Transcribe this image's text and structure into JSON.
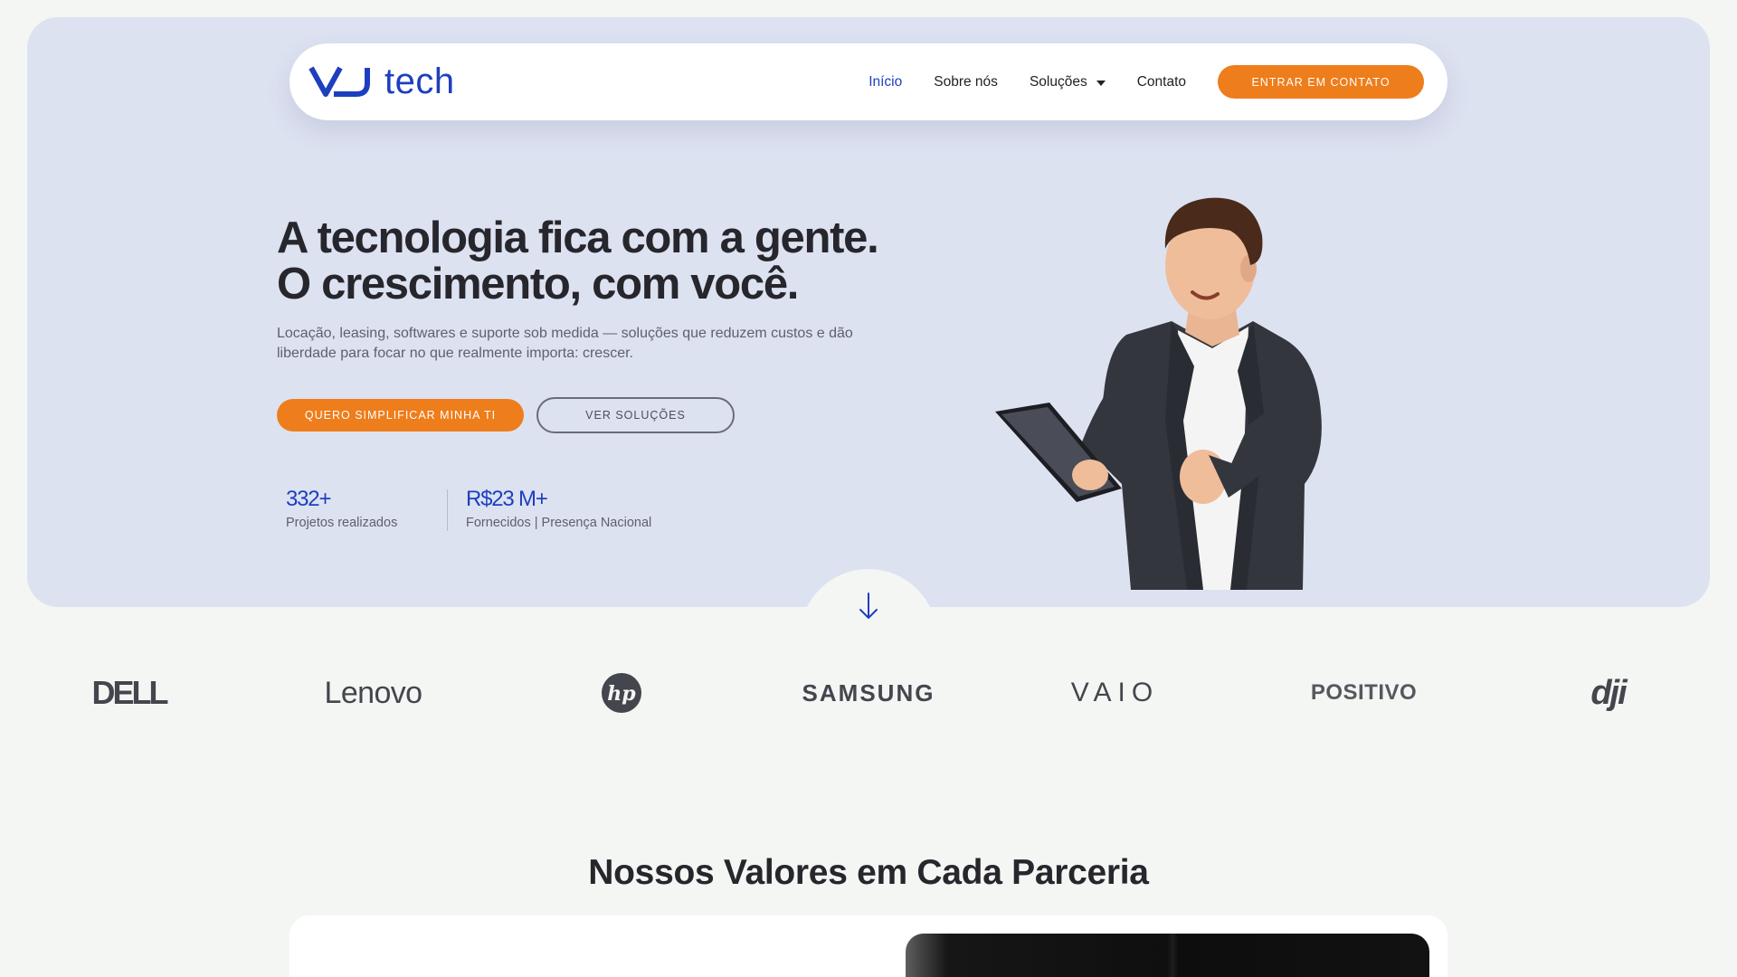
{
  "brand": {
    "logo_text": "tech",
    "color": "#1d3fbf",
    "accent": "#ee7d1b"
  },
  "nav": {
    "items": [
      {
        "label": "Início",
        "active": true
      },
      {
        "label": "Sobre nós"
      },
      {
        "label": "Soluções",
        "has_dropdown": true
      },
      {
        "label": "Contato"
      }
    ],
    "cta_label": "ENTRAR EM CONTATO"
  },
  "hero": {
    "headline_line1": "A tecnologia fica com a gente.",
    "headline_line2": "O crescimento, com você.",
    "subtext": "Locação, leasing, softwares e suporte sob medida — soluções que reduzem custos e dão liberdade para focar no que realmente importa: crescer.",
    "cta_primary": "QUERO SIMPLIFICAR MINHA TI",
    "cta_secondary": "VER SOLUÇÕES",
    "stats": [
      {
        "value": "332+",
        "label": "Projetos realizados"
      },
      {
        "value": "R$23 M+",
        "label": "Fornecidos | Presença Nacional"
      }
    ],
    "scroll_icon": "arrow-down-icon"
  },
  "partners": {
    "logos": [
      "DELL",
      "Lenovo",
      "hp",
      "SAMSUNG",
      "VAIO",
      "POSITIVO",
      "dji"
    ]
  },
  "values": {
    "title": "Nossos Valores em Cada Parceria"
  }
}
